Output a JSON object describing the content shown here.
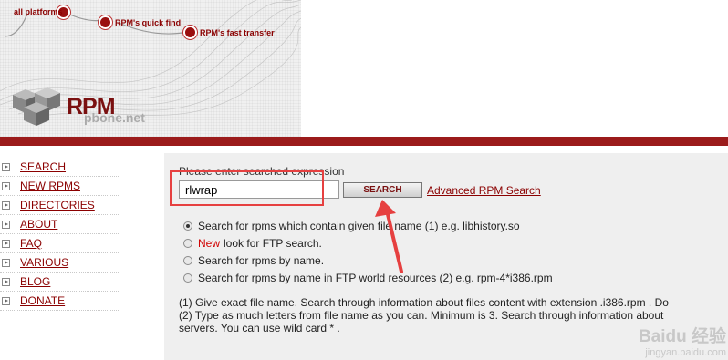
{
  "header": {
    "nodes": [
      "all platforms",
      "RPM's quick find",
      "RPM's fast transfer"
    ],
    "logo_title": "RPM",
    "logo_subtitle": "pbone.net"
  },
  "sidebar": {
    "items": [
      {
        "label": "SEARCH"
      },
      {
        "label": "NEW RPMS"
      },
      {
        "label": "DIRECTORIES"
      },
      {
        "label": "ABOUT"
      },
      {
        "label": "FAQ"
      },
      {
        "label": "VARIOUS"
      },
      {
        "label": "BLOG"
      },
      {
        "label": "DONATE"
      }
    ]
  },
  "search": {
    "prompt": "Please enter searched expression",
    "value": "rlwrap",
    "button_label": "SEARCH",
    "advanced_link": "Advanced RPM Search"
  },
  "options": [
    {
      "text": "Search for rpms which contain given file name (1) e.g. libhistory.so",
      "selected": true
    },
    {
      "prefix": "New",
      "text": "look for FTP search.",
      "selected": false
    },
    {
      "text": "Search for rpms by name.",
      "selected": false
    },
    {
      "text": "Search for rpms by name in FTP world resources (2) e.g. rpm-4*i386.rpm",
      "selected": false
    }
  ],
  "notes": [
    "(1) Give exact file name. Search through information about files content with extension .i386.rpm . Do",
    "(2) Type as much letters from file name as you can. Minimum is 3. Search through information about",
    "servers. You can use wild card * ."
  ],
  "watermark": {
    "line1": "Baidu 经验",
    "line2": "jingyan.baidu.com"
  },
  "colors": {
    "brand_red": "#9b1b1b",
    "link": "#8b0000",
    "annotation": "#e64040"
  }
}
